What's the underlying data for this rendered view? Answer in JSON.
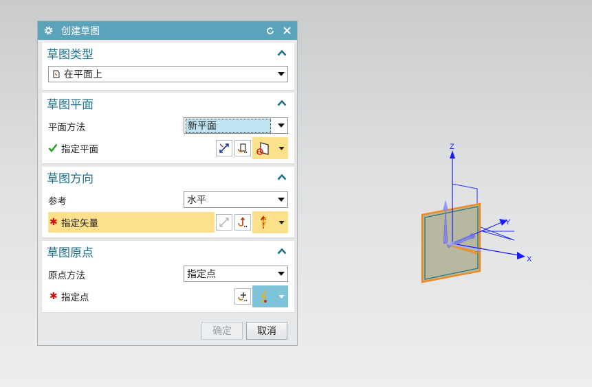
{
  "dialog": {
    "title": "创建草图",
    "icons": {
      "settings": "gear-icon",
      "reset": "reset-icon",
      "close": "close-icon"
    }
  },
  "sections": {
    "sketch_type": {
      "title": "草图类型",
      "type_value": "在平面上"
    },
    "sketch_plane": {
      "title": "草图平面",
      "plane_method_label": "平面方法",
      "plane_method_value": "新平面",
      "specify_plane_label": "指定平面",
      "status_icon": "checkmark-icon"
    },
    "sketch_orientation": {
      "title": "草图方向",
      "reference_label": "参考",
      "reference_value": "水平",
      "specify_vector_label": "指定矢量",
      "required_mark": "✱"
    },
    "sketch_origin": {
      "title": "草图原点",
      "origin_method_label": "原点方法",
      "origin_method_value": "指定点",
      "specify_point_label": "指定点",
      "required_mark": "✱"
    }
  },
  "footer": {
    "ok_label": "确定",
    "cancel_label": "取消"
  },
  "viewport": {
    "axis_labels": {
      "x": "X",
      "y": "Y",
      "z": "Z"
    }
  },
  "colors": {
    "titlebar": "#5aa3bb",
    "section_title": "#1d6f8e",
    "highlight_row": "#fde08a",
    "active_button": "#7dc3d9",
    "plane_fill": "#b8b8a0",
    "plane_edge": "#f08a20",
    "axis": "#1a1aff"
  }
}
